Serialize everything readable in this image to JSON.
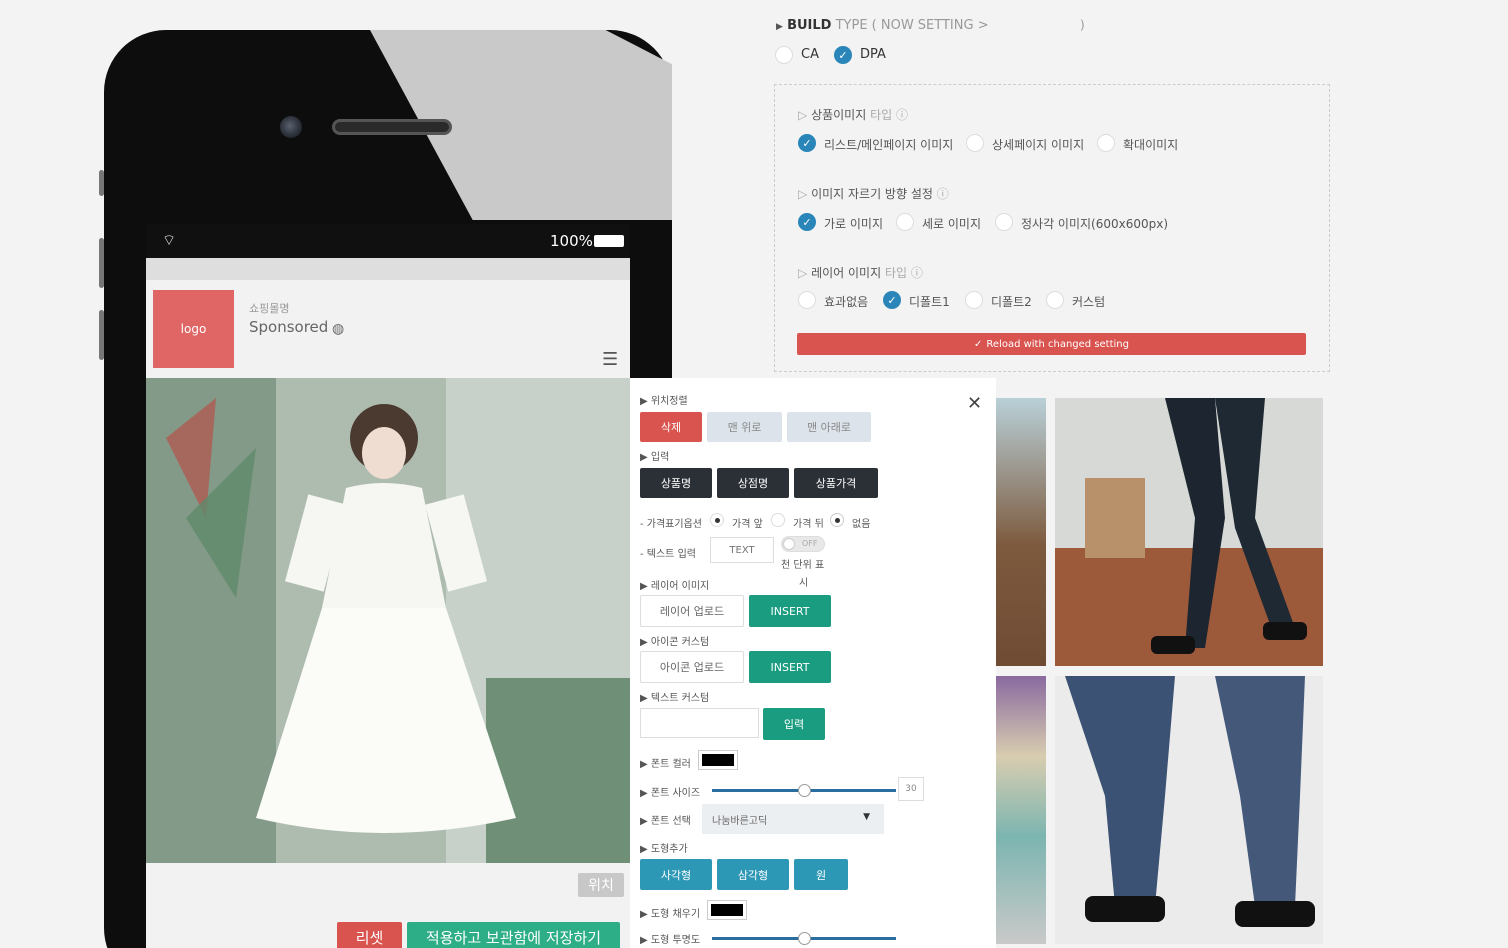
{
  "build_type": {
    "label": "BUILD",
    "suffix": "TYPE ( NOW SETTING >",
    "close_paren": ")",
    "options": [
      {
        "label": "CA",
        "selected": false
      },
      {
        "label": "DPA",
        "selected": true
      }
    ]
  },
  "settings": {
    "product_image_type": {
      "title": "상품이미지",
      "title_muted": "타입",
      "options": [
        {
          "label": "리스트/메인페이지 이미지",
          "selected": true
        },
        {
          "label": "상세페이지 이미지",
          "selected": false
        },
        {
          "label": "확대이미지",
          "selected": false
        }
      ]
    },
    "crop_direction": {
      "title": "이미지 자르기 방향 설정",
      "options": [
        {
          "label": "가로 이미지",
          "selected": true
        },
        {
          "label": "세로 이미지",
          "selected": false
        },
        {
          "label": "정사각 이미지(600x600px)",
          "selected": false
        }
      ]
    },
    "layer_image_type": {
      "title": "레이어 이미지",
      "title_muted": "타입",
      "options": [
        {
          "label": "효과없음",
          "selected": false
        },
        {
          "label": "디폴트1",
          "selected": true
        },
        {
          "label": "디폴트2",
          "selected": false
        },
        {
          "label": "커스텀",
          "selected": false
        }
      ]
    },
    "reload_button": "Reload with changed setting"
  },
  "phone": {
    "status_battery": "100%",
    "logo": "logo",
    "shop_name": "쇼핑몰명",
    "sponsored": "Sponsored",
    "position_button": "위치",
    "reset_button": "리셋",
    "apply_button": "적용하고 보관함에 저장하기"
  },
  "editor": {
    "position_order": {
      "title": "위치정렬",
      "buttons": [
        "삭제",
        "맨 위로",
        "맨 아래로"
      ]
    },
    "input": {
      "title": "입력",
      "buttons": [
        "상품명",
        "상점명",
        "상품가격"
      ]
    },
    "price_symbol": {
      "label": "- 가격표기옵션",
      "options": [
        {
          "label": "가격 앞",
          "selected": false
        },
        {
          "label": "가격 뒤",
          "selected": false
        },
        {
          "label": "없음",
          "selected": true
        }
      ]
    },
    "text_input": {
      "label": "- 텍스트 입력",
      "placeholder": "TEXT",
      "toggle": "OFF",
      "note_line1": "천 단위 표",
      "note_line2": "시"
    },
    "layer_image": {
      "title": "레이어 이미지",
      "upload": "레이어 업로드",
      "insert": "INSERT"
    },
    "icon_custom": {
      "title": "아이콘 커스텀",
      "upload": "아이콘 업로드",
      "insert": "INSERT"
    },
    "text_custom": {
      "title": "텍스트 커스텀",
      "submit": "입력"
    },
    "font_color": {
      "title": "폰트 컬러",
      "value": "#000000"
    },
    "font_size": {
      "title": "폰트 사이즈",
      "value": "30",
      "fraction": 0.5
    },
    "font_select": {
      "title": "폰트 선택",
      "value": "나눔바른고딕"
    },
    "shape_add": {
      "title": "도형추가",
      "buttons": [
        "사각형",
        "삼각형",
        "원"
      ]
    },
    "shape_fill": {
      "title": "도형 채우기",
      "value": "#000000"
    },
    "shape_opacity": {
      "title": "도형 투명도",
      "fraction": 0.5
    }
  },
  "colors": {
    "accent_red": "#d9534f",
    "accent_blue": "#2a86b8",
    "teal": "#199c7f",
    "dark": "#2b2f36"
  }
}
